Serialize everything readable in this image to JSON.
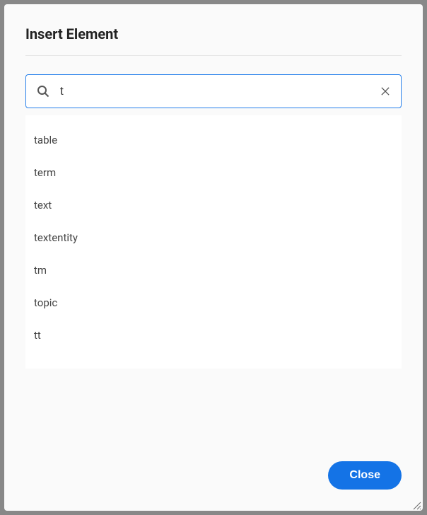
{
  "dialog": {
    "title": "Insert Element"
  },
  "search": {
    "value": "t",
    "placeholder": ""
  },
  "results": [
    "table",
    "term",
    "text",
    "textentity",
    "tm",
    "topic",
    "tt"
  ],
  "buttons": {
    "close": "Close"
  }
}
